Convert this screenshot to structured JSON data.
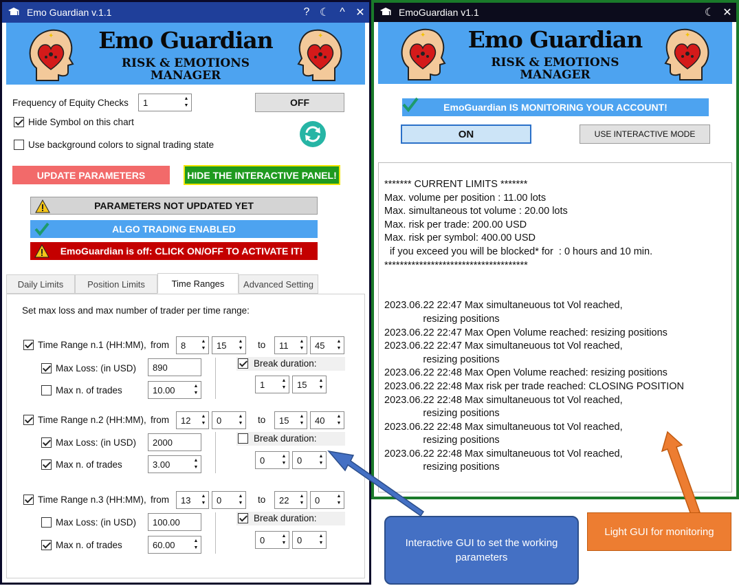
{
  "left_window": {
    "title": "Emo Guardian v.1.1",
    "title_buttons": [
      "?",
      "☾",
      "^",
      "✕"
    ],
    "banner": {
      "title": "Emo Guardian",
      "subtitle_line1": "RISK & EMOTIONS",
      "subtitle_line2": "MANAGER"
    },
    "frequency_label": "Frequency of Equity Checks",
    "frequency_value": "1",
    "off_button": "OFF",
    "hide_symbol_label": "Hide Symbol on this chart",
    "hide_symbol_checked": true,
    "bg_colors_label": "Use background colors to signal trading state",
    "bg_colors_checked": false,
    "update_button": "UPDATE PARAMETERS",
    "hide_panel_button": "HIDE THE INTERACTIVE  PANEL!",
    "status_params": "PARAMETERS NOT UPDATED YET",
    "status_algo": "ALGO TRADING ENABLED",
    "status_off": "EmoGuardian is off: CLICK ON/OFF TO ACTIVATE IT!",
    "tabs": [
      "Daily Limits",
      "Position Limits",
      "Time Ranges",
      "Advanced Setting"
    ],
    "active_tab": "Time Ranges",
    "time_ranges": {
      "intro": "Set max loss and max number of trader per time range:",
      "from_word": "from",
      "to_word": "to",
      "max_loss_label": "Max Loss: (in USD)",
      "max_trades_label": "Max n. of trades",
      "break_label": "Break duration:",
      "ranges": [
        {
          "label": "Time Range n.1 (HH:MM),",
          "enabled": true,
          "from_h": "8",
          "from_m": "15",
          "to_h": "11",
          "to_m": "45",
          "max_loss_checked": true,
          "max_loss": "890",
          "max_trades_checked": false,
          "max_trades": "10.00",
          "break_checked": true,
          "break_h": "1",
          "break_m": "15"
        },
        {
          "label": "Time Range n.2 (HH:MM),",
          "enabled": true,
          "from_h": "12",
          "from_m": "0",
          "to_h": "15",
          "to_m": "40",
          "max_loss_checked": true,
          "max_loss": "2000",
          "max_trades_checked": true,
          "max_trades": "3.00",
          "break_checked": false,
          "break_h": "0",
          "break_m": "0"
        },
        {
          "label": "Time Range n.3 (HH:MM),",
          "enabled": true,
          "from_h": "13",
          "from_m": "0",
          "to_h": "22",
          "to_m": "0",
          "max_loss_checked": false,
          "max_loss": "100.00",
          "max_trades_checked": true,
          "max_trades": "60.00",
          "break_checked": true,
          "break_h": "0",
          "break_m": "0"
        }
      ]
    }
  },
  "right_window": {
    "title": "EmoGuardian v1.1",
    "title_buttons": [
      "☾",
      "✕"
    ],
    "banner": {
      "title": "Emo Guardian",
      "subtitle_line1": "RISK & EMOTIONS",
      "subtitle_line2": "MANAGER"
    },
    "monitoring_status": "EmoGuardian IS MONITORING YOUR ACCOUNT!",
    "on_button": "ON",
    "interactive_button": "USE INTERACTIVE MODE",
    "log": [
      "******* CURRENT LIMITS *******",
      "Max. volume per position : 11.00 lots",
      "Max. simultaneous tot volume : 20.00 lots",
      "Max. risk per trade: 200.00 USD",
      "Max. risk per symbol: 400.00 USD",
      "  if you exceed you will be blocked* for  : 0 hours and 10 min.",
      "*************************************",
      "",
      "",
      "2023.06.22 22:47 Max simultaneuous tot Vol reached,",
      "              resizing positions",
      "2023.06.22 22:47 Max Open Volume reached: resizing positions",
      "2023.06.22 22:47 Max simultaneuous tot Vol reached,",
      "              resizing positions",
      "2023.06.22 22:48 Max Open Volume reached: resizing positions",
      "2023.06.22 22:48 Max risk per trade reached: CLOSING POSITION",
      "2023.06.22 22:48 Max simultaneuous tot Vol reached,",
      "              resizing positions",
      "2023.06.22 22:48 Max simultaneuous tot Vol reached,",
      "              resizing positions",
      "2023.06.22 22:48 Max simultaneuous tot Vol reached,",
      "              resizing positions"
    ]
  },
  "callouts": {
    "interactive": "Interactive GUI to set the working parameters",
    "light": "Light GUI for monitoring"
  },
  "colors": {
    "title_bar_left": "#1f3f9a",
    "banner": "#4da3f0",
    "update_button": "#f26a6a",
    "hide_panel_button": "#1f9a1f",
    "status_algo": "#4da3f0",
    "status_off": "#c40000",
    "callout_blue": "#4470c4",
    "callout_orange": "#ed7d31",
    "right_border": "#1a7a2a"
  }
}
